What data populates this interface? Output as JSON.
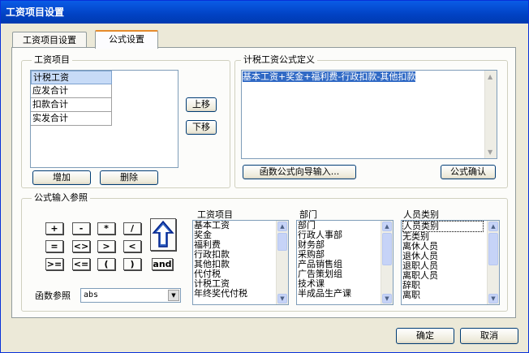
{
  "window": {
    "title": "工资项目设置"
  },
  "tabs": [
    {
      "label": "工资项目设置"
    },
    {
      "label": "公式设置"
    }
  ],
  "salary_items": {
    "label": "工资项目",
    "rows": [
      "计税工资",
      "应发合计",
      "扣款合计",
      "实发合计"
    ],
    "selected": 0,
    "up_label": "上移",
    "down_label": "下移",
    "add_label": "增加",
    "delete_label": "删除"
  },
  "formula_def": {
    "label": "计税工资公式定义",
    "formula": "基本工资+奖金+福利费-行政扣款-其他扣款",
    "wizard_label": "函数公式向导输入...",
    "confirm_label": "公式确认"
  },
  "formula_ref": {
    "label": "公式输入参照",
    "operators": [
      "+",
      "-",
      "*",
      "/",
      "=",
      "<>",
      ">",
      "<",
      ">=",
      "<=",
      "(",
      ")"
    ],
    "and_label": "and",
    "func_label": "函数参照",
    "func_value": "abs",
    "lists": [
      {
        "title": "工资项目",
        "items": [
          "基本工资",
          "奖金",
          "福利费",
          "行政扣款",
          "其他扣款",
          "代付税",
          "计税工资",
          "年终奖代付税"
        ]
      },
      {
        "title": "部门",
        "items": [
          "部门",
          "行政人事部",
          "财务部",
          "采购部",
          "产品销售组",
          "广告策划组",
          "技术课",
          "半成品生产课"
        ]
      },
      {
        "title": "人员类别",
        "items": [
          "人员类别",
          "无类别",
          "离休人员",
          "退休人员",
          "退职人员",
          "离职人员",
          "辞职",
          "离职"
        ]
      }
    ]
  },
  "footer": {
    "ok_label": "确定",
    "cancel_label": "取消"
  }
}
